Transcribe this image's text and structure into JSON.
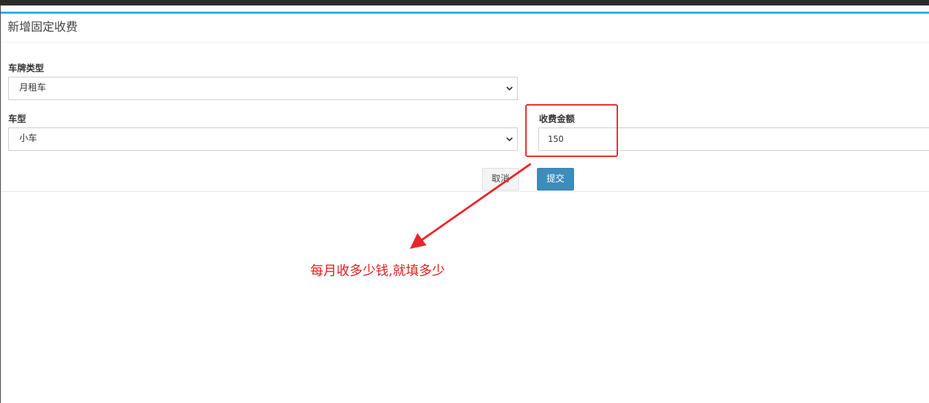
{
  "form": {
    "title": "新增固定收费",
    "plate_type": {
      "label": "车牌类型",
      "selected": "月租车"
    },
    "car_type": {
      "label": "车型",
      "selected": "小车"
    },
    "fee_amount": {
      "label": "收费金额",
      "value": "150"
    },
    "cancel_label": "取消",
    "submit_label": "提交"
  },
  "annotation": {
    "text": "每月收多少钱,就填多少",
    "color": "#e02020"
  },
  "colors": {
    "accent": "#1ab1e6",
    "submit": "#3c8dbc",
    "highlight": "#e8262a"
  },
  "icons": {
    "dropdown": "chevron-down-icon",
    "annotation_arrow": "arrow-icon"
  }
}
